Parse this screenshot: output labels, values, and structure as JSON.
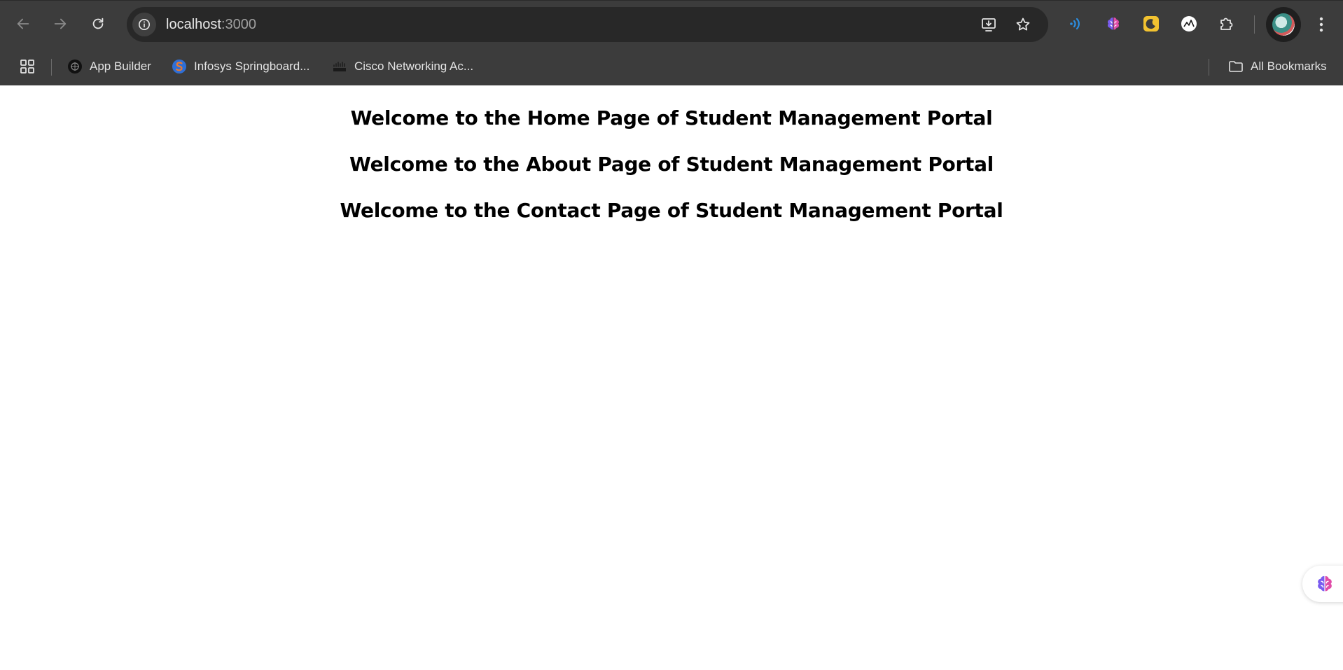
{
  "browser": {
    "nav": {
      "back_icon": "arrow-left-icon",
      "forward_icon": "arrow-right-icon",
      "reload_icon": "reload-icon"
    },
    "omnibox": {
      "host": "localhost",
      "port": ":3000",
      "site_info_icon": "info-icon",
      "install_icon": "install-app-icon",
      "bookmark_icon": "star-icon"
    },
    "extensions": [
      {
        "icon": "sound-waves-icon",
        "color": "#2b8fe3"
      },
      {
        "icon": "brain-icon",
        "color": "#b04cf0"
      },
      {
        "icon": "moon-badge-icon",
        "color": "#f2c230"
      },
      {
        "icon": "chart-circle-icon",
        "color": "#ffffff"
      },
      {
        "icon": "puzzle-icon",
        "color": "#e3e3e3"
      }
    ],
    "menu_icon": "kebab-menu-icon"
  },
  "bookmarks": {
    "apps_icon": "apps-grid-icon",
    "items": [
      {
        "label": "App Builder",
        "icon": "app-builder-icon"
      },
      {
        "label": "Infosys Springboard...",
        "icon": "springboard-icon",
        "color": "#e0702a"
      },
      {
        "label": "Cisco Networking Ac...",
        "icon": "cisco-icon"
      }
    ],
    "all_label": "All Bookmarks",
    "all_icon": "folder-icon"
  },
  "page": {
    "headings": [
      "Welcome to the Home Page of Student Management Portal",
      "Welcome to the About Page of Student Management Portal",
      "Welcome to the Contact Page of Student Management Portal"
    ]
  },
  "floating_extension": {
    "icon": "brain-icon"
  },
  "colors": {
    "chrome_bg": "#3c3c3c",
    "omnibox_bg": "#282828",
    "page_bg": "#ffffff",
    "heading_text": "#000000"
  }
}
